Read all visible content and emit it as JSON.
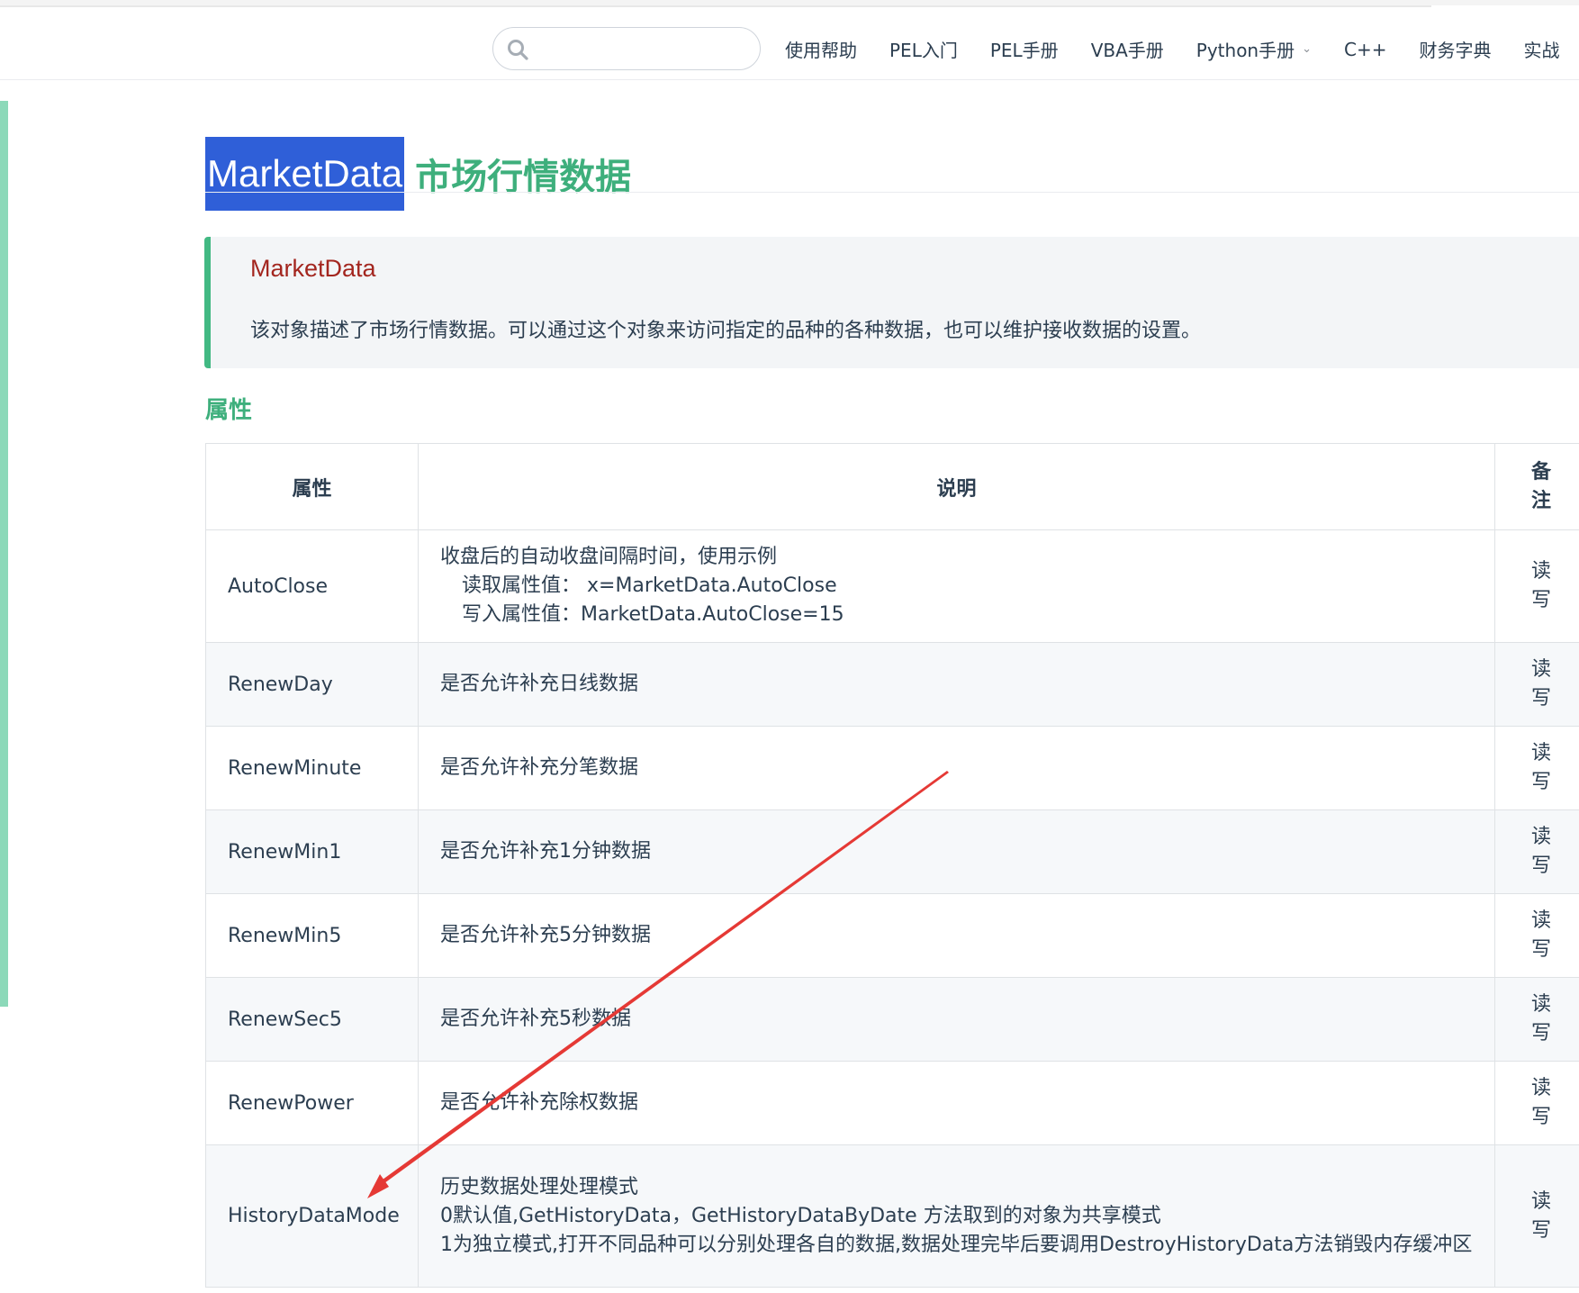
{
  "nav": {
    "search": {
      "value": "",
      "placeholder": ""
    },
    "links": [
      {
        "label": "使用帮助"
      },
      {
        "label": "PEL入门"
      },
      {
        "label": "PEL手册"
      },
      {
        "label": "VBA手册"
      },
      {
        "label": "Python手册",
        "has_dropdown": true
      },
      {
        "label": "C++"
      },
      {
        "label": "财务字典"
      },
      {
        "label": "实战"
      }
    ]
  },
  "page": {
    "title_highlight": "MarketData",
    "title_rest": "市场行情数据"
  },
  "tip": {
    "title": "MarketData",
    "text": "该对象描述了市场行情数据。可以通过这个对象来访问指定的品种的各种数据，也可以维护接收数据的设置。"
  },
  "section": {
    "title": "属性"
  },
  "table": {
    "headers": {
      "prop": "属性",
      "desc": "说明",
      "note": "备注"
    },
    "rows": [
      {
        "prop": "AutoClose",
        "desc": [
          "收盘后的自动收盘间隔时间，使用示例",
          "读取属性值：  x=MarketData.AutoClose",
          "写入属性值：MarketData.AutoClose=15"
        ],
        "note": "读写"
      },
      {
        "prop": "RenewDay",
        "desc": [
          "是否允许补充日线数据"
        ],
        "note": "读写"
      },
      {
        "prop": "RenewMinute",
        "desc": [
          "是否允许补充分笔数据"
        ],
        "note": "读写"
      },
      {
        "prop": "RenewMin1",
        "desc": [
          "是否允许补充1分钟数据"
        ],
        "note": "读写"
      },
      {
        "prop": "RenewMin5",
        "desc": [
          "是否允许补充5分钟数据"
        ],
        "note": "读写"
      },
      {
        "prop": "RenewSec5",
        "desc": [
          "是否允许补充5秒数据"
        ],
        "note": "读写"
      },
      {
        "prop": "RenewPower",
        "desc": [
          "是否允许补充除权数据"
        ],
        "note": "读写"
      },
      {
        "prop": "HistoryDataMode",
        "desc": [
          "历史数据处理处理模式",
          "0默认值,GetHistoryData，GetHistoryDataByDate 方法取到的对象为共享模式",
          "1为独立模式,打开不同品种可以分别处理各自的数据,数据处理完毕后要调用DestroyHistoryData方法销毁内存缓冲区"
        ],
        "note": "读写"
      }
    ]
  },
  "colors": {
    "accent_green": "#3eaf7c",
    "tip_border": "#42b983",
    "title_highlight_bg": "#2f5fd8",
    "annotation_arrow": "#e53935",
    "tip_title": "#a3261f"
  }
}
